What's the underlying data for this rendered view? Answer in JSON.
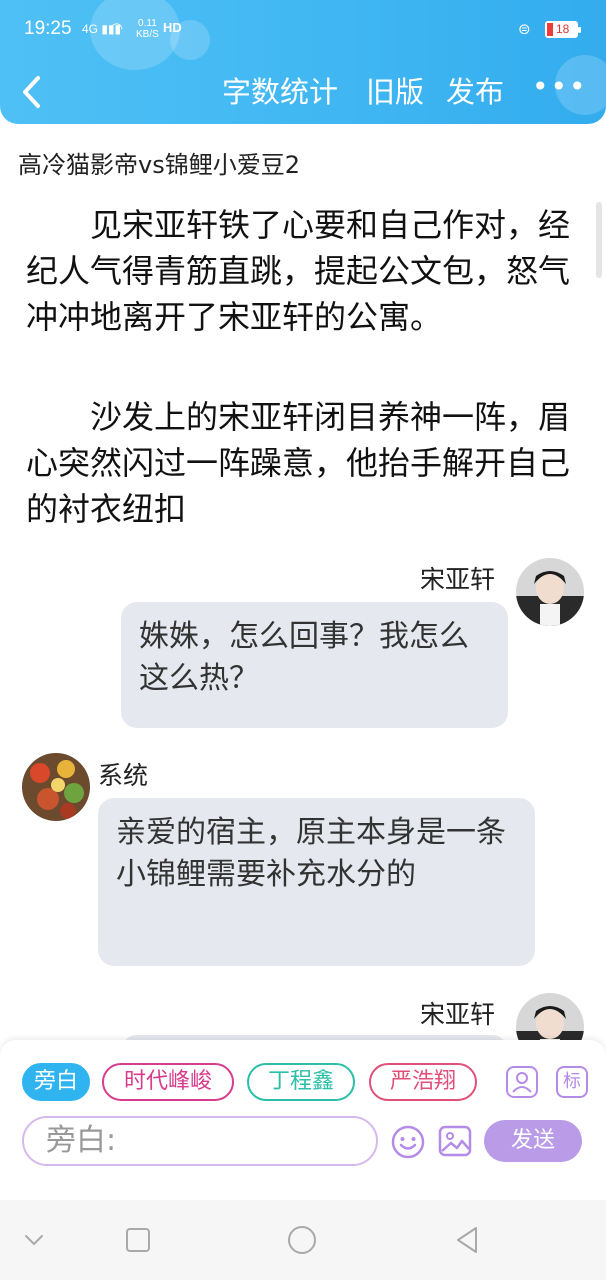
{
  "status_bar": {
    "time": "19:25",
    "signal": "4G",
    "speed_value": "0.11",
    "speed_unit": "KB/S",
    "hd": "HD",
    "battery": "18"
  },
  "header": {
    "word_count": "字数统计",
    "old_version": "旧版",
    "publish": "发布",
    "more": "•••"
  },
  "story_title": "高冷猫影帝vs锦鲤小爱豆2",
  "paragraphs": [
    "见宋亚轩铁了心要和自己作对，经纪人气得青筋直跳，提起公文包，怒气冲冲地离开了宋亚轩的公寓。",
    "沙发上的宋亚轩闭目养神一阵，眉心突然闪过一阵躁意，他抬手解开自己的衬衣纽扣"
  ],
  "messages": [
    {
      "speaker": "宋亚轩",
      "side": "right",
      "text": "姝姝，怎么回事？我怎么这么热？"
    },
    {
      "speaker": "系统",
      "side": "left",
      "text": "亲爱的宿主，原主本身是一条小锦鲤需要补充水分的"
    },
    {
      "speaker": "宋亚轩",
      "side": "right",
      "text": ""
    }
  ],
  "characters": [
    {
      "label": "旁白",
      "color": "#2fb4f0",
      "active": true
    },
    {
      "label": "时代峰峻",
      "color": "#d83c8c",
      "active": false
    },
    {
      "label": "丁程鑫",
      "color": "#2bbfa8",
      "active": false
    },
    {
      "label": "严浩翔",
      "color": "#e0507a",
      "active": false
    }
  ],
  "tools": {
    "tag_label": "标"
  },
  "input": {
    "placeholder": "旁白:"
  },
  "send_label": "发送",
  "colors": {
    "header": "#3fb6f2",
    "bubble": "#e5e9ef",
    "accent": "#b99be8"
  }
}
